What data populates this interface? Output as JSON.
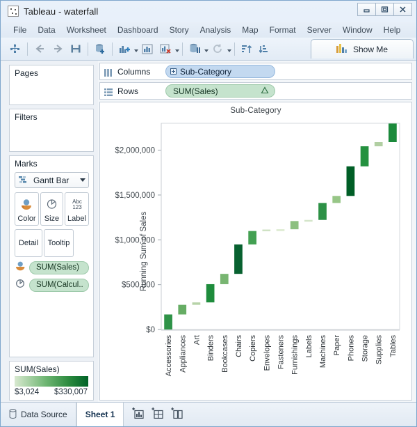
{
  "window": {
    "title": "Tableau - waterfall",
    "app_icon": "tableau-icon",
    "buttons": {
      "minimize": "minimize-icon",
      "restore": "restore-icon",
      "close": "close-icon"
    }
  },
  "menubar": {
    "items": [
      "File",
      "Data",
      "Worksheet",
      "Dashboard",
      "Story",
      "Analysis",
      "Map",
      "Format",
      "Server",
      "Window",
      "Help"
    ]
  },
  "toolbar": {
    "buttons": [
      "tableau-home-icon",
      "back-arrow-icon",
      "forward-arrow-icon",
      "save-icon",
      "new-data-source-icon",
      "new-worksheet-icon",
      "duplicate-sheet-icon",
      "clear-sheet-icon",
      "swap-data-icon",
      "refresh-icon",
      "sort-ascending-icon",
      "sort-descending-icon"
    ],
    "show_me_label": "Show Me",
    "show_me_icon": "show-me-bars-icon"
  },
  "sidebar": {
    "pages": {
      "title": "Pages"
    },
    "filters": {
      "title": "Filters"
    },
    "marks": {
      "title": "Marks",
      "mark_type": "Gantt Bar",
      "mark_type_icon": "gantt-bar-icon",
      "dropdown_icon": "chevron-down-icon",
      "property_buttons": [
        {
          "label": "Color",
          "icon": "color-palette-icon"
        },
        {
          "label": "Size",
          "icon": "size-icon"
        },
        {
          "label": "Label",
          "icon": "abc-123-icon"
        },
        {
          "label": "Detail",
          "icon": "detail-icon"
        },
        {
          "label": "Tooltip",
          "icon": "tooltip-icon"
        }
      ],
      "encodings": [
        {
          "icon": "color-palette-icon",
          "label": "SUM(Sales)"
        },
        {
          "icon": "size-icon",
          "label": "SUM(Calcul.."
        }
      ]
    },
    "legend": {
      "title": "SUM(Sales)",
      "min": "$3,024",
      "max": "$330,007",
      "gradient_start": "#d8e9d0",
      "gradient_end": "#006227"
    }
  },
  "shelves": {
    "columns": {
      "label": "Columns",
      "icon": "columns-icon",
      "pill": {
        "text": "Sub-Category",
        "icon": "expand-plus-icon",
        "color": "#c3d9f0"
      }
    },
    "rows": {
      "label": "Rows",
      "icon": "rows-icon",
      "pill": {
        "text": "SUM(Sales)",
        "icon": "delta-triangle-icon",
        "color": "#c5e3cd"
      }
    }
  },
  "statusbar": {
    "data_source": {
      "label": "Data Source",
      "icon": "data-source-icon"
    },
    "sheet_tab": {
      "label": "Sheet 1"
    },
    "icons": [
      "new-worksheet-icon",
      "new-dashboard-icon",
      "new-story-icon"
    ]
  },
  "chart_data": {
    "type": "bar",
    "subtype": "waterfall",
    "title": "Sub-Category",
    "xlabel": "",
    "ylabel": "Running Sum of Sales",
    "ylim": [
      0,
      2300000
    ],
    "yticks": [
      0,
      500000,
      1000000,
      1500000,
      2000000
    ],
    "ytick_labels": [
      "$0",
      "$500,000",
      "$1,000,000",
      "$1,500,000",
      "$2,000,000"
    ],
    "grid": false,
    "legend_position": "right-panel",
    "categories": [
      "Accessories",
      "Appliances",
      "Art",
      "Binders",
      "Bookcases",
      "Chairs",
      "Copiers",
      "Envelopes",
      "Fasteners",
      "Furnishings",
      "Labels",
      "Machines",
      "Paper",
      "Phones",
      "Storage",
      "Supplies",
      "Tables"
    ],
    "series": [
      {
        "name": "Sales",
        "values": [
          167380,
          107532,
          27119,
          203413,
          114880,
          328449,
          149528,
          16476,
          3024,
          91705,
          12486,
          189239,
          78479,
          330007,
          223844,
          46674,
          206966
        ]
      },
      {
        "name": "Running Sum of Sales",
        "values": [
          167380,
          274912,
          302031,
          505444,
          620324,
          948773,
          1098301,
          1114777,
          1117801,
          1209506,
          1221992,
          1411231,
          1489710,
          1819717,
          2043561,
          2090235,
          2297201
        ]
      }
    ],
    "bar_colors": [
      "#2e9247",
      "#66ad64",
      "#b7d3a8",
      "#1e8c3c",
      "#78b571",
      "#086130",
      "#43a052",
      "#cfe2c4",
      "#dceacf",
      "#8cc080",
      "#d4e5ca",
      "#2d9146",
      "#97c687",
      "#005e26",
      "#24913f",
      "#b1cfa2",
      "#1b8a3b"
    ],
    "color_scale": {
      "min_value": 3024,
      "max_value": 330007,
      "min_color": "#d8e9d0",
      "max_color": "#006227"
    }
  }
}
